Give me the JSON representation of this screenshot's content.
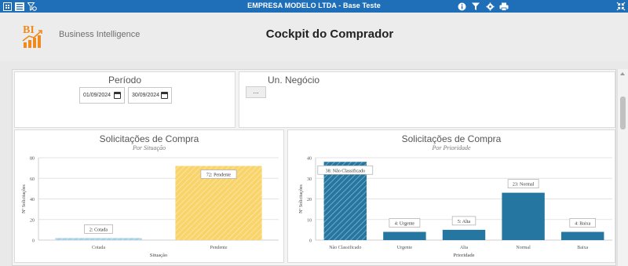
{
  "topbar": {
    "title": "EMPRESA MODELO LTDA - Base Teste",
    "left_icons": [
      "app-grid-icon",
      "menu-icon",
      "filter-clear-icon"
    ],
    "right_icons": [
      "info-icon",
      "filter-icon",
      "settings-icon",
      "print-icon"
    ],
    "collapse_icon": "collapse-icon"
  },
  "header": {
    "logo_text": "BI",
    "bi_label": "Business Intelligence",
    "page_title": "Cockpit do Comprador"
  },
  "filters": {
    "periodo": {
      "label": "Período",
      "start": "01/09/2024",
      "end": "30/09/2024"
    },
    "un_negocio": {
      "label": "Un. Negócio",
      "button": "..."
    }
  },
  "colors": {
    "topbar": "#1f6fb8",
    "cotada": "#a7cfe6",
    "pendente": "#f8d46a",
    "prioridade": "#2577a1"
  },
  "chart_data": [
    {
      "type": "bar",
      "title": "Solicitações de Compra",
      "subtitle": "Por Situação",
      "xlabel": "Situação",
      "ylabel": "Nº Solicitações",
      "ylim": [
        0,
        80
      ],
      "yticks": [
        0,
        20,
        40,
        60,
        80
      ],
      "categories": [
        "Cotada",
        "Pendente"
      ],
      "values": [
        2,
        72
      ],
      "data_labels": [
        "2: Cotada",
        "72: Pendente"
      ],
      "grid": true
    },
    {
      "type": "bar",
      "title": "Solicitações de Compra",
      "subtitle": "Por Prioridade",
      "xlabel": "Prioridade",
      "ylabel": "Nº Solicitações",
      "ylim": [
        0,
        40
      ],
      "yticks": [
        0,
        10,
        20,
        30,
        40
      ],
      "categories": [
        "Não Classificado",
        "Urgente",
        "Alta",
        "Normal",
        "Baixa"
      ],
      "values": [
        38,
        4,
        5,
        23,
        4
      ],
      "data_labels": [
        "38: Não Classificado",
        "4: Urgente",
        "5: Alta",
        "23: Normal",
        "4: Baixa"
      ],
      "grid": true
    }
  ]
}
